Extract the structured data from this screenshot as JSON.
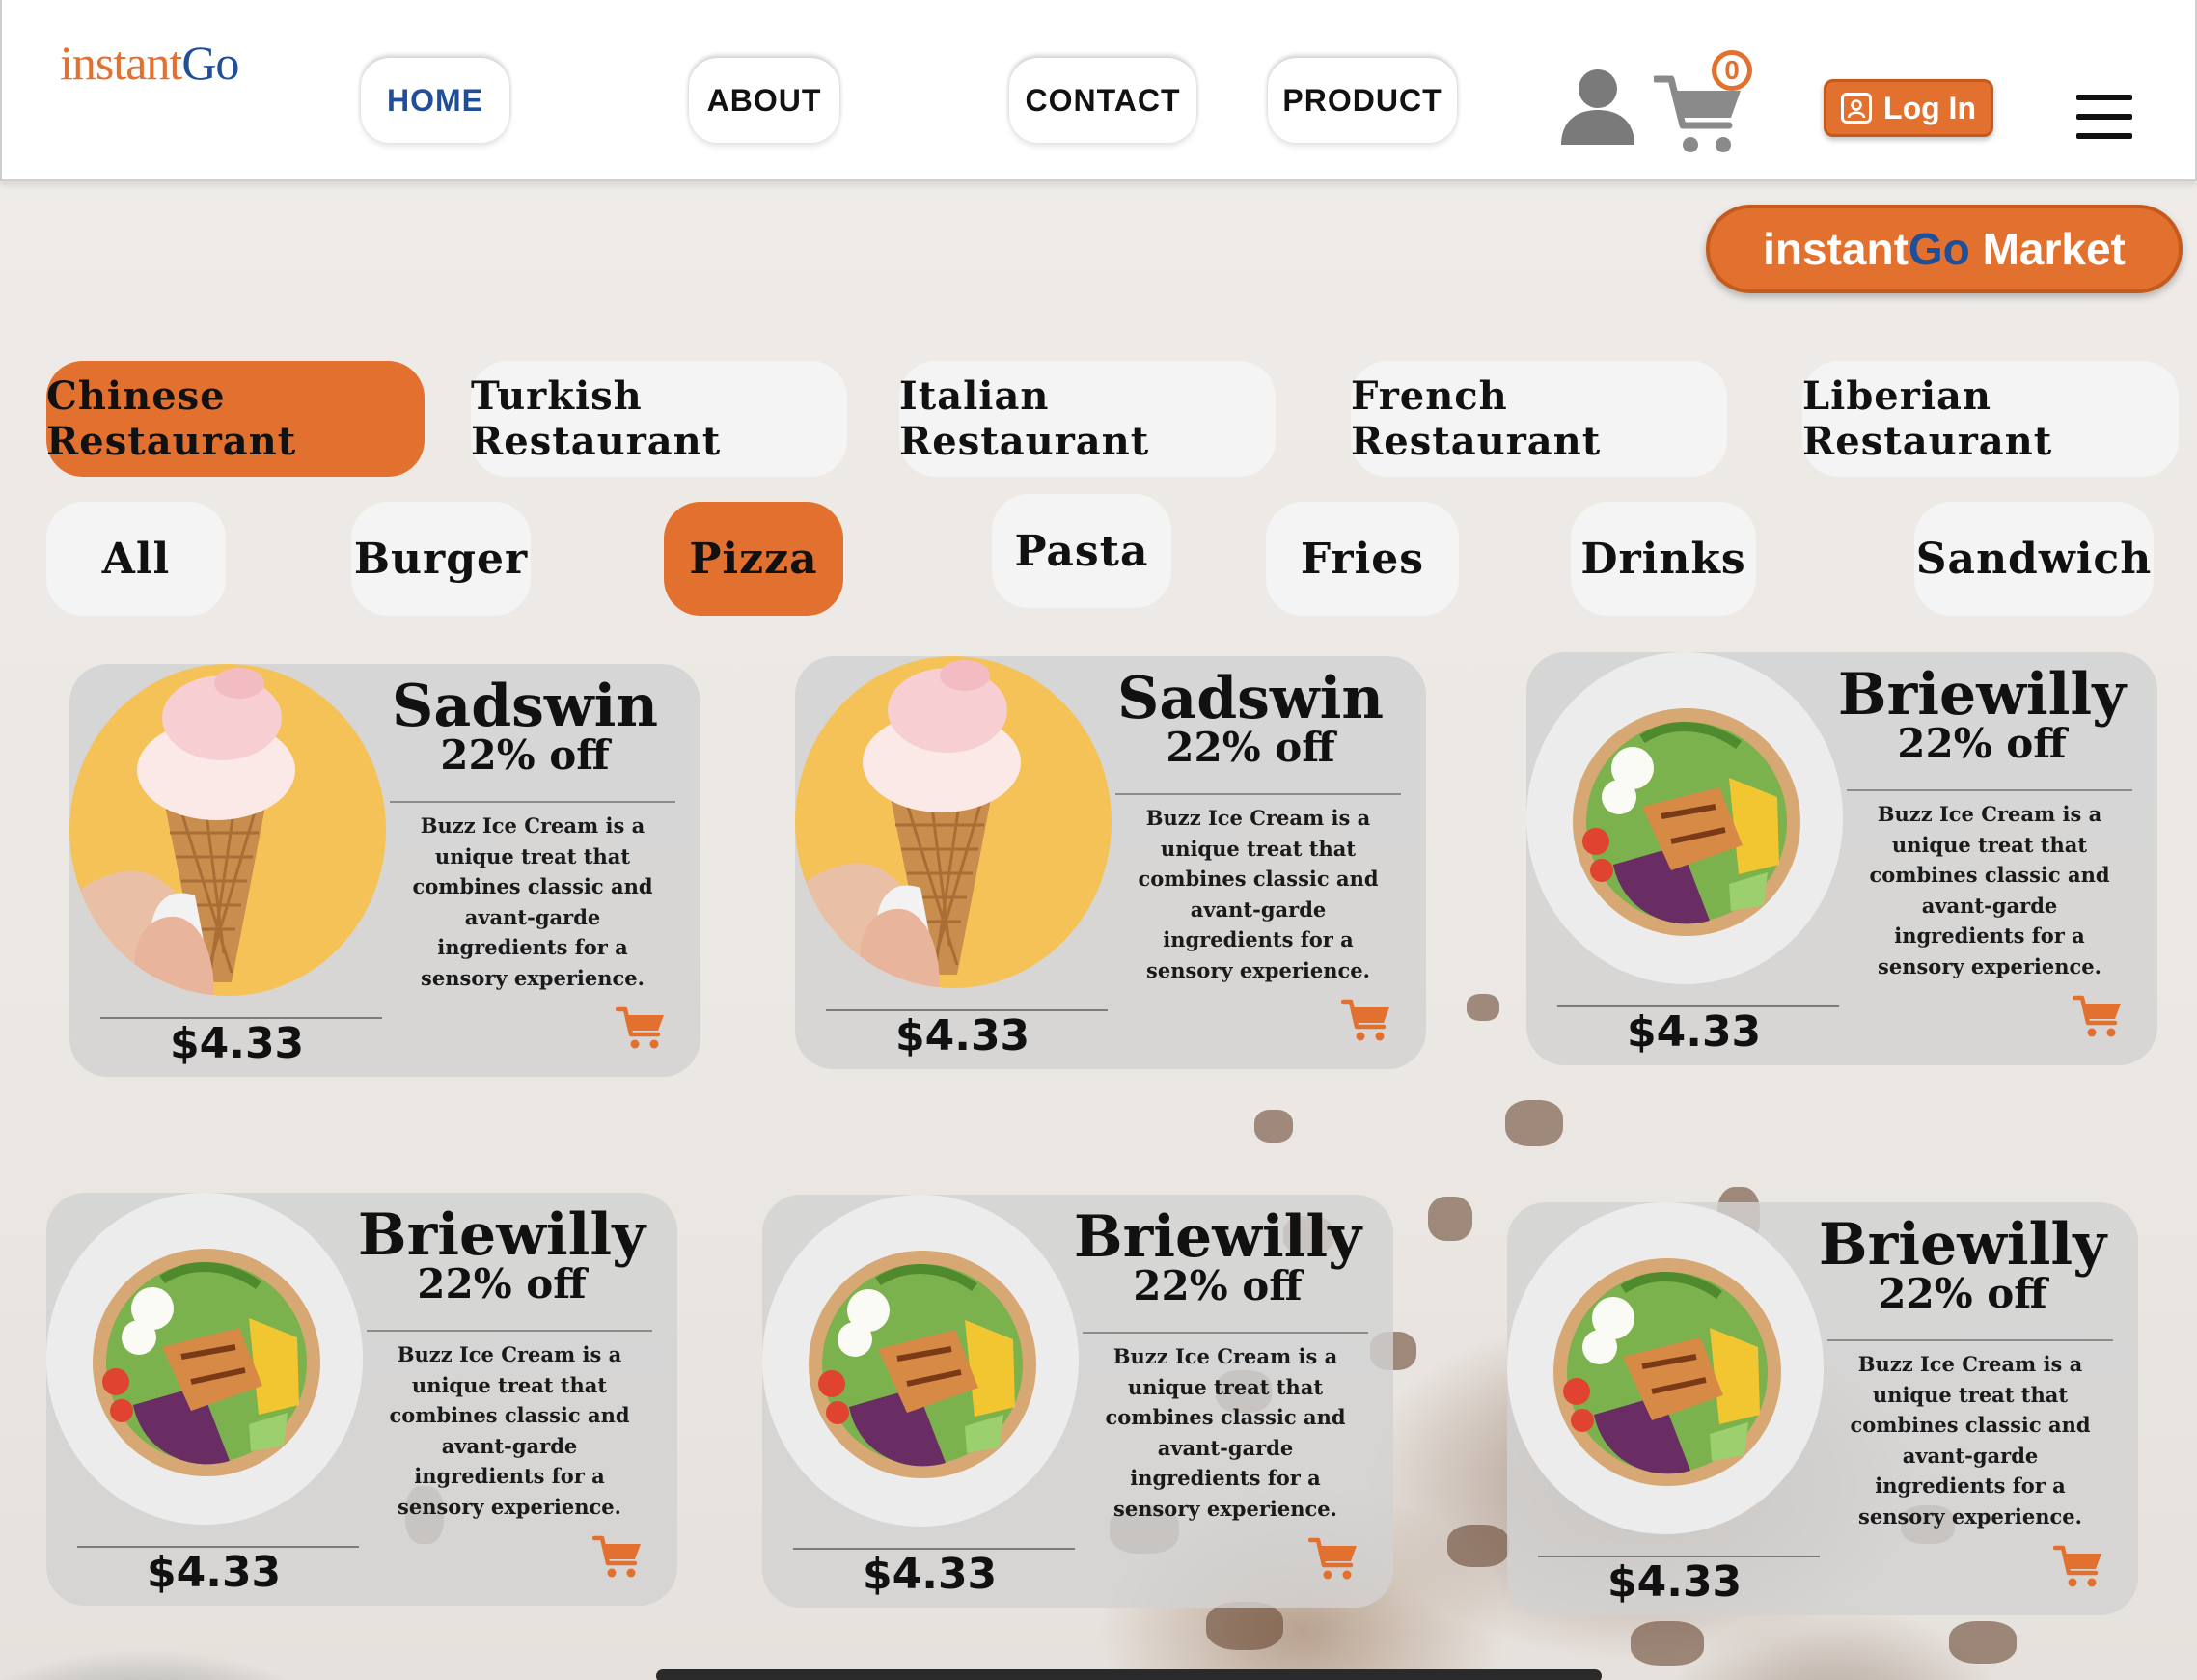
{
  "brand": {
    "logo_part1": "instant",
    "logo_part2": "Go"
  },
  "nav": {
    "home": "HOME",
    "about": "ABOUT",
    "contact": "CONTACT",
    "product": "PRODUCT"
  },
  "cart": {
    "count": "0"
  },
  "login": {
    "label": "Log In"
  },
  "market": {
    "part1": "instant",
    "part2": "Go",
    "part3": " Market"
  },
  "restaurants": [
    {
      "label": "Chinese Restaurant",
      "active": true
    },
    {
      "label": "Turkish Restaurant",
      "active": false
    },
    {
      "label": "Italian Restaurant",
      "active": false
    },
    {
      "label": "French Restaurant",
      "active": false
    },
    {
      "label": "Liberian Restaurant",
      "active": false
    }
  ],
  "categories": [
    {
      "label": "All",
      "active": false
    },
    {
      "label": "Burger",
      "active": false
    },
    {
      "label": "Pizza",
      "active": true
    },
    {
      "label": "Pasta",
      "active": false
    },
    {
      "label": "Fries",
      "active": false
    },
    {
      "label": "Drinks",
      "active": false
    },
    {
      "label": "Sandwich",
      "active": false
    }
  ],
  "products": [
    {
      "name": "Sadswin",
      "discount": "22% off",
      "description": "Buzz Ice Cream is a unique treat that combines classic and avant-garde ingredients for a sensory experience.",
      "price": "$4.33",
      "image": "ice-cream-cone"
    },
    {
      "name": "Sadswin",
      "discount": "22% off",
      "description": "Buzz Ice Cream is a unique treat that combines classic and avant-garde ingredients for a sensory experience.",
      "price": "$4.33",
      "image": "ice-cream-cone"
    },
    {
      "name": "Briewilly",
      "discount": "22% off",
      "description": "Buzz Ice Cream is a unique treat that combines classic and avant-garde ingredients for a sensory experience.",
      "price": "$4.33",
      "image": "salad-bowl"
    },
    {
      "name": "Briewilly",
      "discount": "22% off",
      "description": "Buzz Ice Cream is a unique treat that combines classic and avant-garde ingredients for a sensory experience.",
      "price": "$4.33",
      "image": "salad-bowl"
    },
    {
      "name": "Briewilly",
      "discount": "22% off",
      "description": "Buzz Ice Cream is a unique treat that combines classic and avant-garde ingredients for a sensory experience.",
      "price": "$4.33",
      "image": "salad-bowl"
    },
    {
      "name": "Briewilly",
      "discount": "22% off",
      "description": "Buzz Ice Cream is a unique treat that combines classic and avant-garde ingredients for a sensory experience.",
      "price": "$4.33",
      "image": "salad-bowl"
    }
  ],
  "colors": {
    "accent": "#e2712f",
    "brand_blue": "#1f4f9a",
    "pill": "#f4f4f4",
    "card": "#d2d2d2"
  },
  "icons": [
    "user-icon",
    "cart-icon",
    "login-icon",
    "hamburger-menu-icon",
    "add-to-cart-icon"
  ]
}
